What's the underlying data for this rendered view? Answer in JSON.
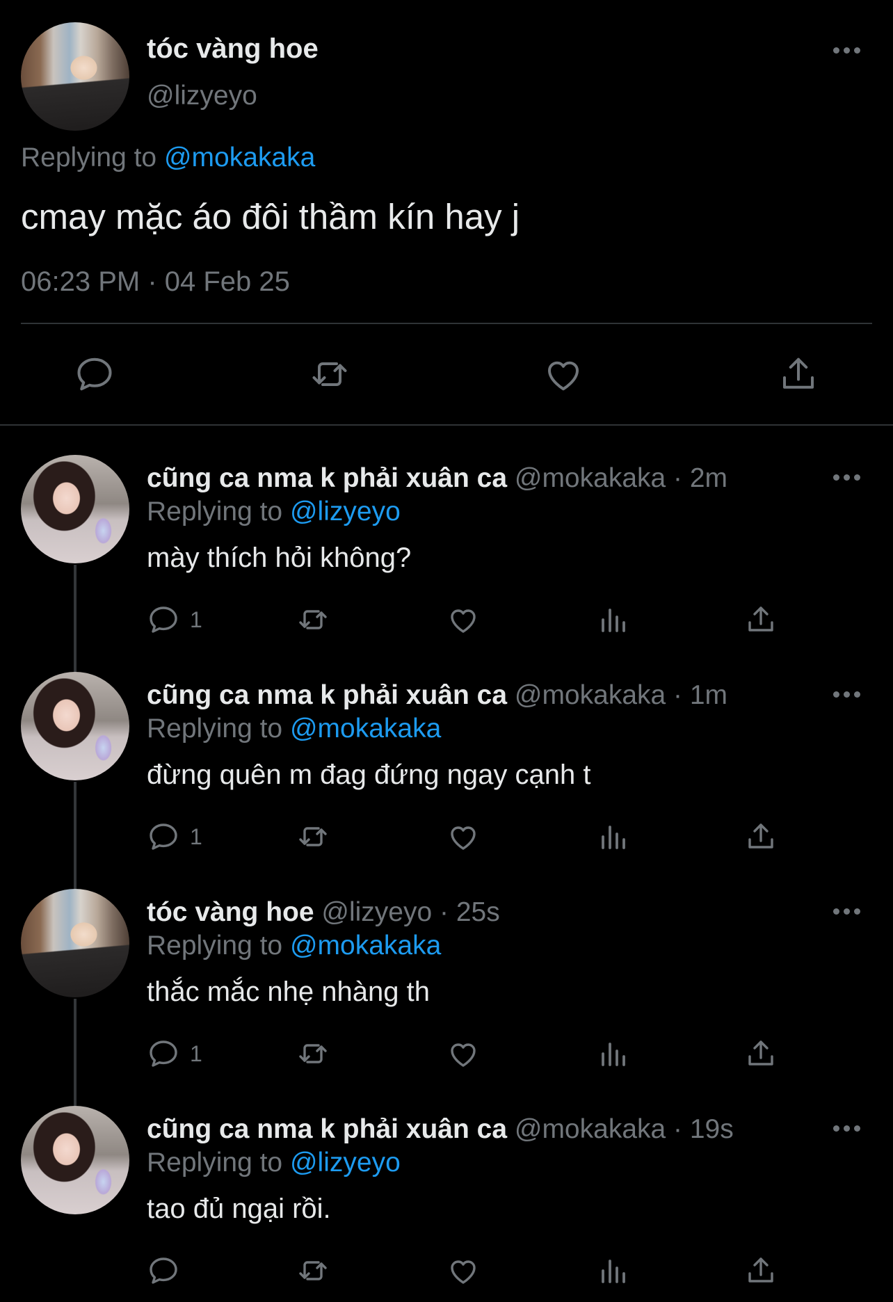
{
  "main_tweet": {
    "name": "tóc vàng hoe",
    "handle": "@lizyeyo",
    "replying_prefix": "Replying to",
    "replying_to": "@mokakaka",
    "text": "cmay mặc áo đôi thầm kín hay j",
    "timestamp": "06:23 PM · 04 Feb 25",
    "actions": [
      "reply-icon",
      "retweet-icon",
      "like-icon",
      "share-icon"
    ]
  },
  "replies": [
    {
      "name": "cũng ca nma k phải xuân ca",
      "meta": "@mokakaka · 2m",
      "replying_prefix": "Replying to",
      "replying_to": "@lizyeyo",
      "text": "mày thích hỏi không?",
      "reply_count": "1"
    },
    {
      "name": "cũng ca nma k phải xuân ca",
      "meta": "@mokakaka · 1m",
      "replying_prefix": "Replying to",
      "replying_to": "@mokakaka",
      "text": "đừng quên m đag đứng ngay cạnh t",
      "reply_count": "1"
    },
    {
      "name": "tóc vàng hoe",
      "meta": "@lizyeyo · 25s",
      "replying_prefix": "Replying to",
      "replying_to": "@mokakaka",
      "text": "thắc mắc nhẹ nhàng th",
      "reply_count": "1"
    },
    {
      "name": "cũng ca nma k phải xuân ca",
      "meta": "@mokakaka · 19s",
      "replying_prefix": "Replying to",
      "replying_to": "@lizyeyo",
      "text": "tao đủ ngại rồi.",
      "reply_count": ""
    }
  ],
  "colors": {
    "background": "#000000",
    "text": "#e7e9ea",
    "muted": "#71767b",
    "link": "#1d9bf0",
    "divider": "#2f3336"
  }
}
